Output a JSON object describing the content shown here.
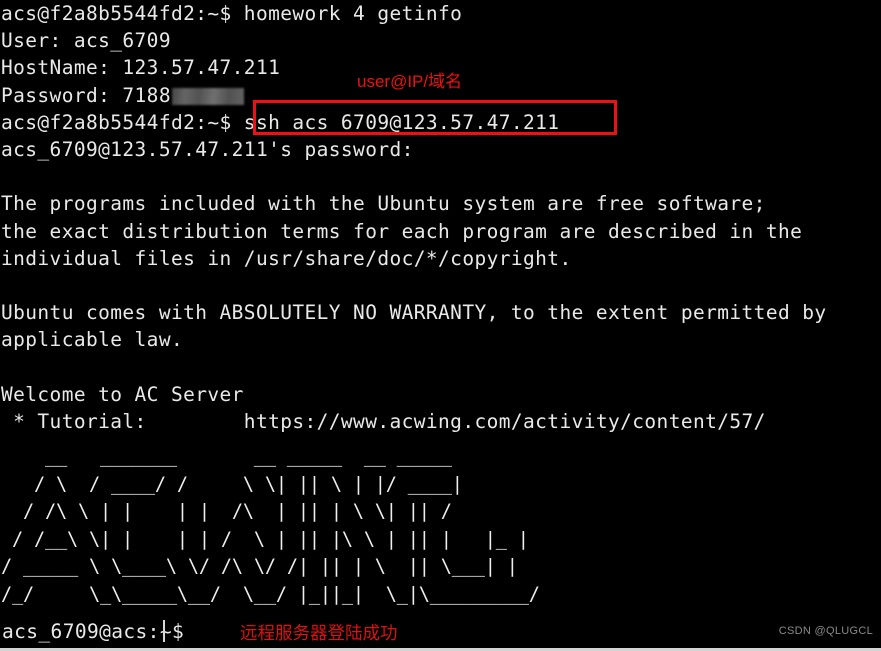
{
  "terminal": {
    "background_color": "#000000",
    "foreground_color": "#e9e9e9",
    "lines": {
      "l1_prompt_local": "acs@f2a8b5544fd2:~$ homework 4 getinfo",
      "l2_user": "User: acs_6709",
      "l3_hostname": "HostName: 123.57.47.211",
      "l4_password_label": "Password: 7188",
      "l5_prompt_ssh": "acs@f2a8b5544fd2:~$ ssh acs_6709@123.57.47.211",
      "l6_password_prompt": "acs_6709@123.57.47.211's password:",
      "l7_blank": "",
      "l8_motd1": "The programs included with the Ubuntu system are free software;",
      "l9_motd2": "the exact distribution terms for each program are described in the",
      "l10_motd3": "individual files in /usr/share/doc/*/copyright.",
      "l11_blank": "",
      "l12_warranty1": "Ubuntu comes with ABSOLUTELY NO WARRANTY, to the extent permitted by",
      "l13_warranty2": "applicable law.",
      "l14_blank": "",
      "l15_welcome": "Welcome to AC Server",
      "l16_tutorial": " * Tutorial:        https://www.acwing.com/activity/content/57/",
      "l17_blank": "",
      "l22_blank": "",
      "l23_prompt_remote": "acs_6709@acs:~$"
    },
    "ascii_art": [
      "    __   _______       __ _____  __ _____",
      "   / \\  / ____/ /     \\ \\| || \\ | |/ ____|",
      "  / /\\ \\ | |    | |  /\\  | || | \\ \\| || /",
      " / /__\\ \\| |    | | /  \\ | || |\\ \\ | || |   |_ |",
      "/ _____ \\ \\____\\ \\/ /\\ \\/ /| || | \\  || \\___| |",
      "/_/     \\_\\_____\\__/  \\__/ |_||_|  \\_|\\_________/"
    ]
  },
  "annotations": {
    "ssh_label": "user@IP/域名",
    "ssh_label_color": "#ee1111",
    "highlight_box_color": "#ee1111",
    "login_success": "远程服务器登陆成功",
    "login_success_color": "#dd1111"
  },
  "watermark": {
    "text": "CSDN @QLUGCL"
  }
}
